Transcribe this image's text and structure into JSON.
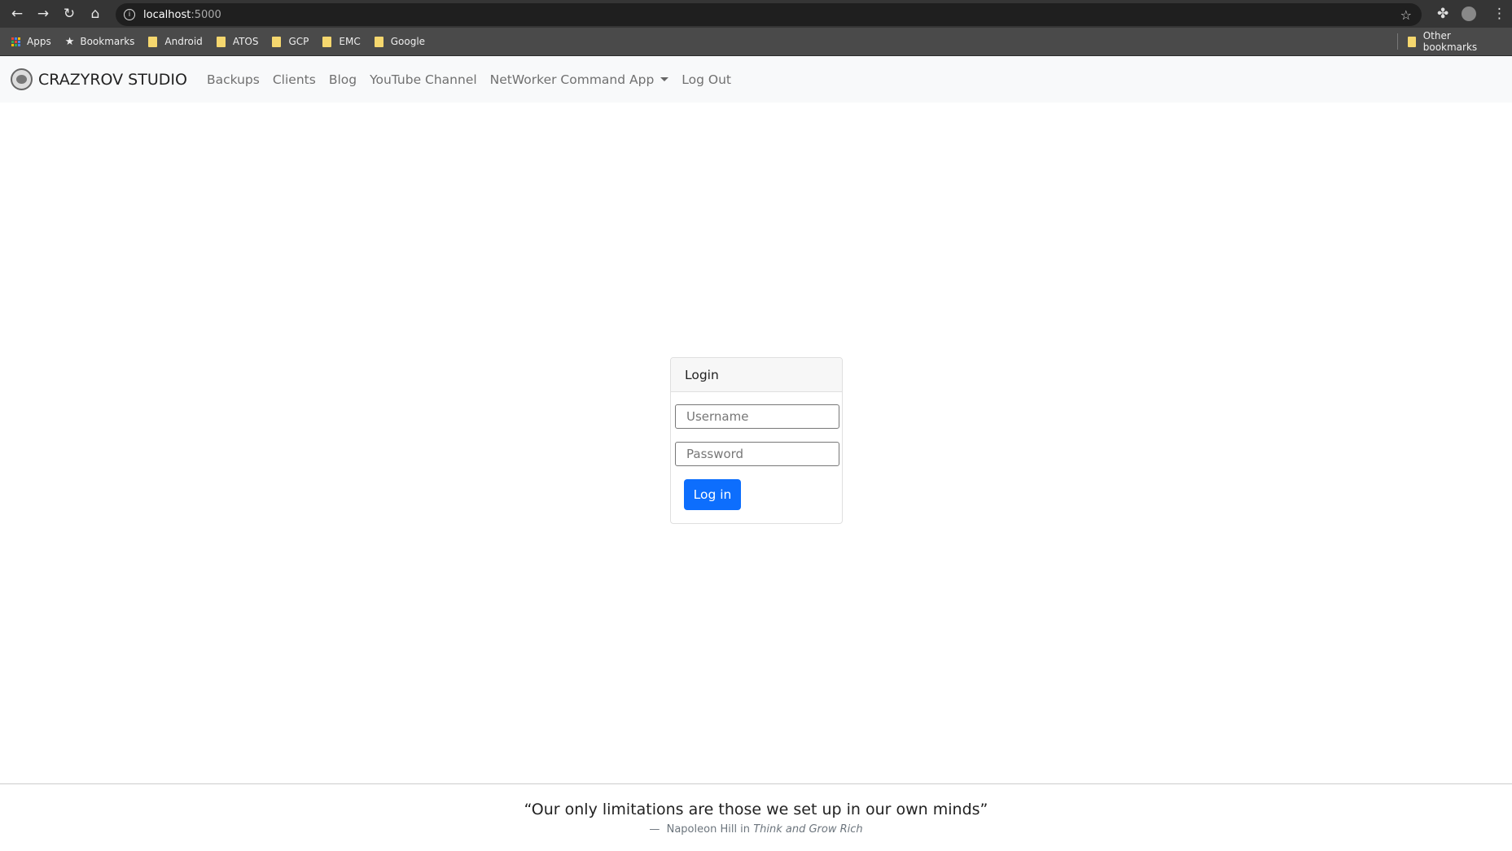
{
  "browser": {
    "url_host": "localhost",
    "url_port": ":5000",
    "bookmarks": [
      {
        "label": "Android"
      },
      {
        "label": "ATOS"
      },
      {
        "label": "GCP"
      },
      {
        "label": "EMC"
      },
      {
        "label": "Google"
      }
    ],
    "apps_label": "Apps",
    "bookmarks_label": "Bookmarks",
    "other_bookmarks": "Other bookmarks"
  },
  "navbar": {
    "brand": "CRAZYROV STUDIO",
    "links": [
      {
        "label": "Backups"
      },
      {
        "label": "Clients"
      },
      {
        "label": "Blog"
      },
      {
        "label": "YouTube Channel"
      },
      {
        "label": "NetWorker Command App"
      },
      {
        "label": "Log Out"
      }
    ]
  },
  "login": {
    "title": "Login",
    "username_placeholder": "Username",
    "password_placeholder": "Password",
    "submit": "Log in",
    "accent": "#0d6efd"
  },
  "footer": {
    "quote": "“Our only limitations are those we set up in our own minds”",
    "dash": "—",
    "author": "Napoleon Hill in",
    "source": "Think and Grow Rich"
  }
}
